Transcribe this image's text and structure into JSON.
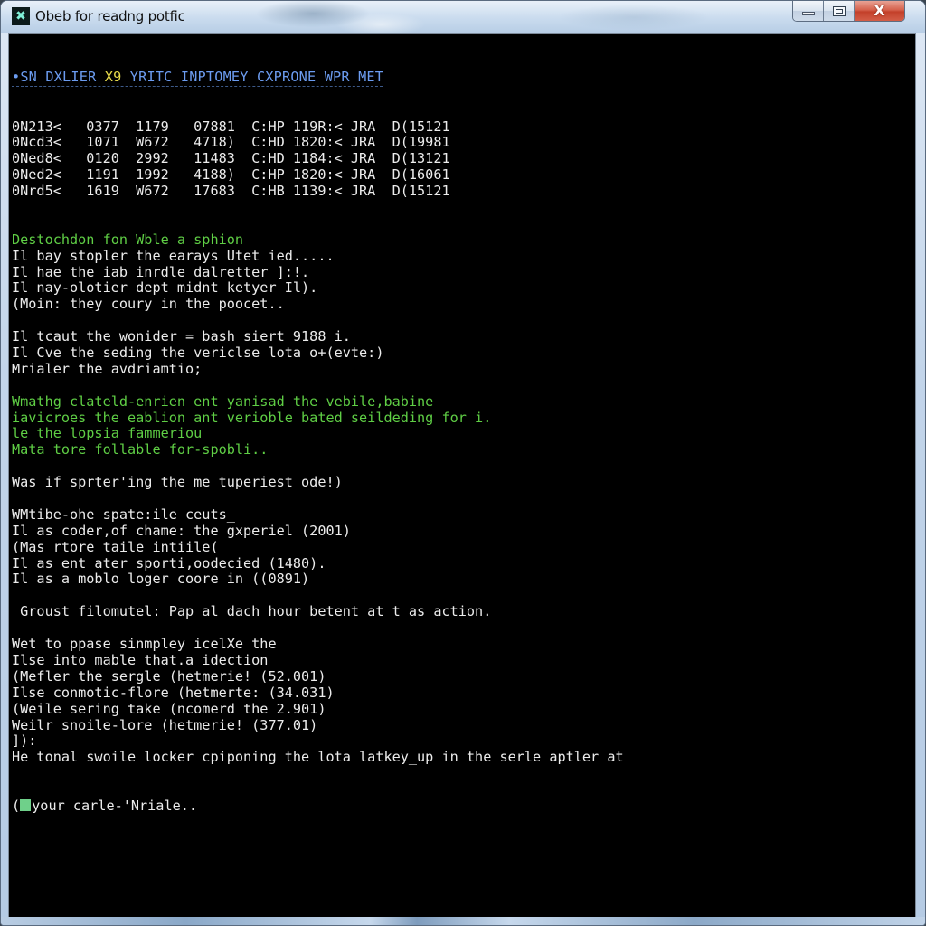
{
  "window": {
    "title": "Obeb for readng potfic",
    "icon": "console-app-icon",
    "buttons": {
      "minimize": "minimize-icon",
      "maximize": "maximize-icon",
      "close": "close-icon"
    }
  },
  "console": {
    "header": {
      "part1": "•SN DXLIER ",
      "highlight": "X9",
      "part2": " YRITC INPTOMEY CXPRONE WPR MET"
    },
    "table_rows": [
      "0N213<   0377  1179   07881  C:HP 119R:< JRA  D(15121",
      "0Ncd3<   1071  W672   4718)  C:HD 1820:< JRA  D(19981",
      "0Ned8<   0120  2992   11483  C:HD 1184:< JRA  D(13121",
      "0Ned2<   1191  1992   4188)  C:HP 1820:< JRA  D(16061",
      "0Nrd5<   1619  W672   17683  C:HB 1139:< JRA  D(15121"
    ],
    "lines": [
      {
        "text": "Destochdon fon Wble a sphion",
        "color": "green"
      },
      {
        "text": "Il bay stopler the earays Utet ied.....",
        "color": "white"
      },
      {
        "text": "Il hae the iab inrdle dalretter ]:!.",
        "color": "white"
      },
      {
        "text": "Il nay-olotier dept midnt ketyer Il).",
        "color": "white"
      },
      {
        "text": "(Moin: they coury in the poocet..",
        "color": "white"
      },
      {
        "text": "",
        "color": "white"
      },
      {
        "text": "Il tcaut the wonider = bash siert 9188 i.",
        "color": "white"
      },
      {
        "text": "Il Cve the seding the vericlse lota o+(evte:)",
        "color": "white"
      },
      {
        "text": "Mrialer the avdriamtio;",
        "color": "white"
      },
      {
        "text": "",
        "color": "white"
      },
      {
        "text": "Wmathg clateld-enrien ent yanisad the vebile,babine",
        "color": "green"
      },
      {
        "text": "iavicroes the eablion ant verioble bated seildeding for i.",
        "color": "green"
      },
      {
        "text": "le the lopsia fammeriou",
        "color": "green"
      },
      {
        "text": "Mata tore follable for-spobli..",
        "color": "green"
      },
      {
        "text": "",
        "color": "white"
      },
      {
        "text": "Was if sprter'ing the me tuperiest ode!)",
        "color": "white"
      },
      {
        "text": "",
        "color": "white"
      },
      {
        "text": "WMtibe-ohe spate:ile ceuts_",
        "color": "white"
      },
      {
        "text": "Il as coder,of chame: the gxperiel (2001)",
        "color": "white"
      },
      {
        "text": "(Mas rtore taile intiile(",
        "color": "white"
      },
      {
        "text": "Il as ent ater sporti,oodecied (1480).",
        "color": "white"
      },
      {
        "text": "Il as a moblo loger coore in ((0891)",
        "color": "white"
      },
      {
        "text": "",
        "color": "white"
      },
      {
        "text": " Groust filomutel: Pap al dach hour betent at t as action.",
        "color": "white"
      },
      {
        "text": "",
        "color": "white"
      },
      {
        "text": "Wet to ppase sinmpley icelXe the",
        "color": "white"
      },
      {
        "text": "Ilse into mable that.a idection",
        "color": "white"
      },
      {
        "text": "(Mefler the sergle (hetmerie! (52.001)",
        "color": "white"
      },
      {
        "text": "Ilse conmotic-flore (hetmerte: (34.031)",
        "color": "white"
      },
      {
        "text": "(Weile sering take (ncomerd the 2.901)",
        "color": "white"
      },
      {
        "text": "Weilr snoile-lore (hetmerie! (377.01)",
        "color": "white"
      },
      {
        "text": "]):",
        "color": "white"
      },
      {
        "text": "He tonal swoile locker cpiponing the lota latkey_up in the serle aptler at",
        "color": "white"
      }
    ],
    "prompt_prefix": "(",
    "prompt_text": "your carle-'Nriale..",
    "cursor_color": "#6fd08a"
  }
}
